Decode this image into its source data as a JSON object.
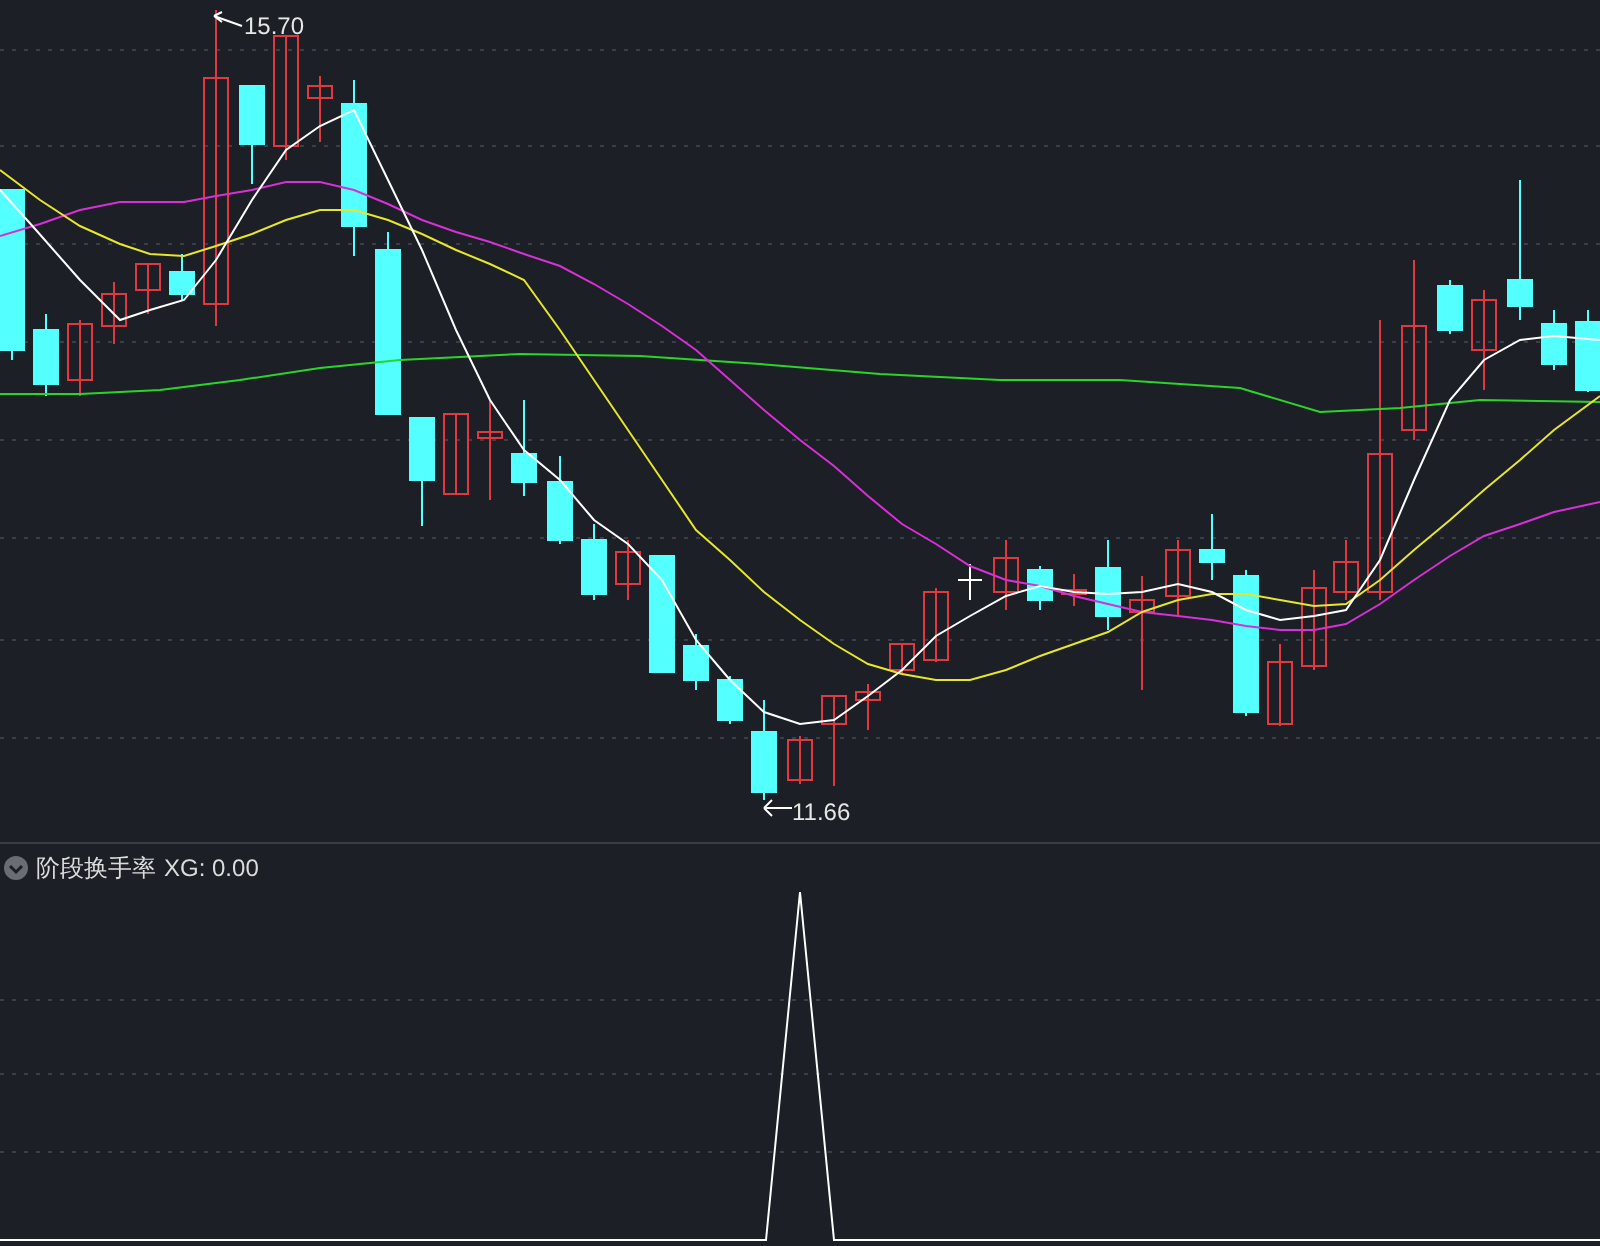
{
  "price_pane": {
    "high_label": "15.70",
    "low_label": "11.66"
  },
  "indicator_pane": {
    "name": "阶段换手率",
    "reading": "XG: 0.00"
  }
}
